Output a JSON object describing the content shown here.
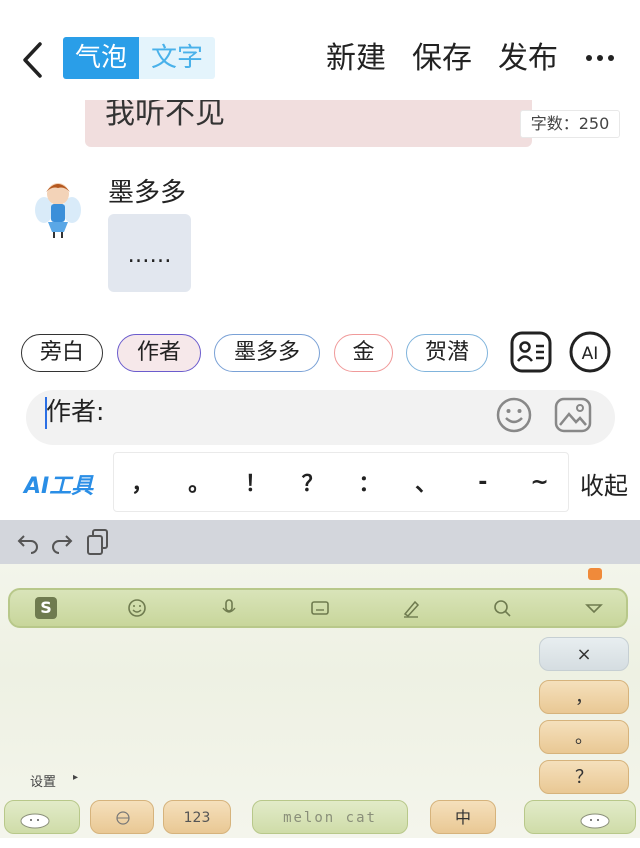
{
  "header": {
    "back_icon": "chevron-left-icon",
    "segments": [
      "气泡",
      "文字"
    ],
    "actions": [
      "新建",
      "保存",
      "发布"
    ],
    "more_icon": "more-dots-icon"
  },
  "chat": {
    "partial_message": "我听不见",
    "char_count": "字数：250",
    "speaker_name": "墨多多",
    "message": "……"
  },
  "roles": [
    "旁白",
    "作者",
    "墨多多",
    "金",
    "贺潜"
  ],
  "role_icons": [
    "contact-card-icon",
    "ai-icon"
  ],
  "input": {
    "value": "作者:",
    "icons": [
      "emoji-icon",
      "image-icon"
    ]
  },
  "toolbar": {
    "ai_tools": "AI工具",
    "punctuation": [
      "，",
      "。",
      "！",
      "？",
      "：",
      "、",
      "-",
      "~"
    ],
    "collapse": "收起"
  },
  "keyboard": {
    "settings": "设置",
    "side_keys": [
      "×",
      "，",
      "。",
      "？"
    ],
    "lang_key": "中",
    "space_label": "melon cat",
    "num_key": "123"
  },
  "colors": {
    "accent": "#2a9ee8",
    "chip_selected_bg": "#f6e8ea",
    "bubble_pink": "#f1dede",
    "bubble_grey": "#e2e7ef",
    "keyboard_green": "#c8d69b",
    "key_orange": "#e9c894"
  }
}
